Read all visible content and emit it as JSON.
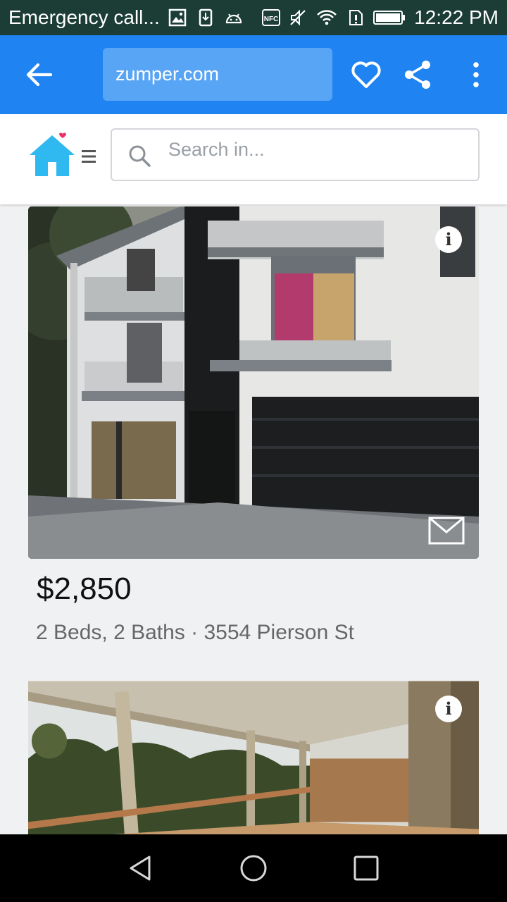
{
  "status_bar": {
    "left_text": "Emergency call...",
    "time": "12:22 PM",
    "icons": [
      "image-icon",
      "download-icon",
      "android-icon",
      "nfc-icon",
      "mute-icon",
      "wifi-icon",
      "sim-alert-icon",
      "battery-icon"
    ],
    "nfc_label": "NFC"
  },
  "browser": {
    "url": "zumper.com",
    "accent_color": "#1f83f2"
  },
  "site": {
    "search_placeholder": "Search in...",
    "logo_color": "#30b8f0"
  },
  "listings": [
    {
      "price": "$2,850",
      "details": "2 Beds, 2 Baths · 3554 Pierson St"
    },
    {
      "price": "",
      "details": ""
    }
  ]
}
